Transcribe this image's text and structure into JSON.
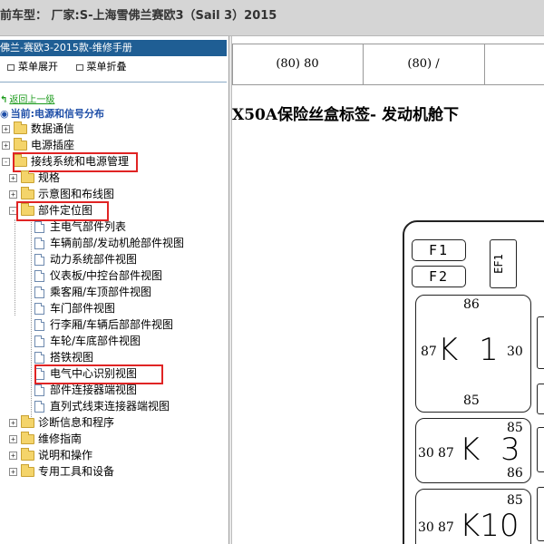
{
  "window": {
    "title": "前车型：  厂家:S-上海雪佛兰赛欧3（Sail 3）2015"
  },
  "sidebar": {
    "manual_title": "佛兰-赛欧3-2015款-维修手册",
    "menu_expand": "菜单展开",
    "menu_collapse": "菜单折叠",
    "back_link": "返回上一级",
    "current_path": "当前:电源和信号分布",
    "tree": [
      {
        "label": "数据通信",
        "toggle": "+",
        "icon": "folder"
      },
      {
        "label": "电源插座",
        "toggle": "+",
        "icon": "folder"
      },
      {
        "label": "接线系统和电源管理",
        "toggle": "-",
        "icon": "folder",
        "highlight": true
      },
      {
        "label": "规格",
        "toggle": "+",
        "icon": "folder"
      },
      {
        "label": "示意图和布线图",
        "toggle": "+",
        "icon": "folder"
      },
      {
        "label": "部件定位图",
        "toggle": "-",
        "icon": "folder",
        "highlight": true
      },
      {
        "label": "主电气部件列表",
        "icon": "document"
      },
      {
        "label": "车辆前部/发动机舱部件视图",
        "icon": "document"
      },
      {
        "label": "动力系统部件视图",
        "icon": "document"
      },
      {
        "label": "仪表板/中控台部件视图",
        "icon": "document"
      },
      {
        "label": "乘客厢/车顶部件视图",
        "icon": "document"
      },
      {
        "label": "车门部件视图",
        "icon": "document"
      },
      {
        "label": "行李厢/车辆后部部件视图",
        "icon": "document"
      },
      {
        "label": "车轮/车底部件视图",
        "icon": "document"
      },
      {
        "label": "搭铁视图",
        "icon": "document"
      },
      {
        "label": "电气中心识别视图",
        "icon": "document",
        "highlight": true
      },
      {
        "label": "部件连接器端视图",
        "icon": "document"
      },
      {
        "label": "直列式线束连接器端视图",
        "icon": "document"
      },
      {
        "label": "诊断信息和程序",
        "toggle": "+",
        "icon": "folder"
      },
      {
        "label": "维修指南",
        "toggle": "+",
        "icon": "folder"
      },
      {
        "label": "说明和操作",
        "toggle": "+",
        "icon": "folder"
      },
      {
        "label": "专用工具和设备",
        "toggle": "+",
        "icon": "folder"
      }
    ]
  },
  "content": {
    "table_cells": [
      "(80) 80",
      "(80) /"
    ],
    "section_title": "X50A保险丝盒标签- 发动机舱下",
    "diagram": {
      "fuses": [
        "F1",
        "F2"
      ],
      "vertical_fuse": "EF1",
      "relays": [
        {
          "name": "K 1",
          "pins": [
            "86",
            "87",
            "30",
            "85"
          ]
        },
        {
          "name": "K 3",
          "pins": [
            "85",
            "30",
            "87",
            "86"
          ]
        },
        {
          "name": "K10",
          "pins": [
            "85",
            "30",
            "87"
          ]
        }
      ]
    }
  },
  "colors": {
    "sidebar_header_bg": "#1f5e94",
    "highlight_border": "#e02424",
    "folder_fill": "#f4d46a",
    "link_green": "#1a9a1a",
    "current_path_blue": "#1f4fa8"
  }
}
